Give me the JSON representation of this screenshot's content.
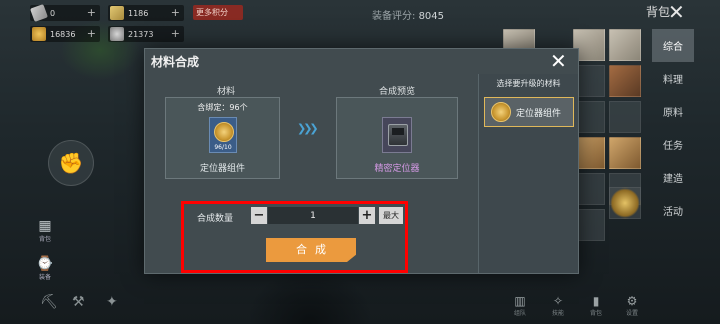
{
  "hud": {
    "resources": [
      {
        "value": "0",
        "icon": "paper-icon"
      },
      {
        "value": "1186",
        "icon": "ticket-icon"
      },
      {
        "value": "16836",
        "icon": "gold-coin-icon"
      },
      {
        "value": "21373",
        "icon": "silver-coin-icon"
      }
    ],
    "more_points": "更多积分",
    "score_label": "装备评分:",
    "score_value": "8045",
    "bag_title": "背包",
    "left_items": [
      "背包",
      "装备"
    ]
  },
  "categories": {
    "tabs": [
      "综合",
      "料理",
      "原料",
      "任务",
      "建造",
      "活动"
    ],
    "active_index": 0
  },
  "bottom_icons": [
    "组队",
    "技能",
    "背包",
    "设置"
  ],
  "modal": {
    "title": "材料合成",
    "material_header": "材料",
    "preview_header": "合成预览",
    "material_count": "含绑定：96个",
    "material_qty": "96/10",
    "material_name": "定位器组件",
    "preview_name": "精密定位器",
    "side_header": "选择要升级的材料",
    "side_item": "定位器组件",
    "quantity_label": "合成数量",
    "quantity_value": "1",
    "minus": "−",
    "plus": "+",
    "max_label": "最大",
    "craft_label": "合成"
  },
  "colors": {
    "craft_button": "#eb9a3e",
    "preview_name": "#d79be8",
    "highlight": "#ff0000"
  }
}
